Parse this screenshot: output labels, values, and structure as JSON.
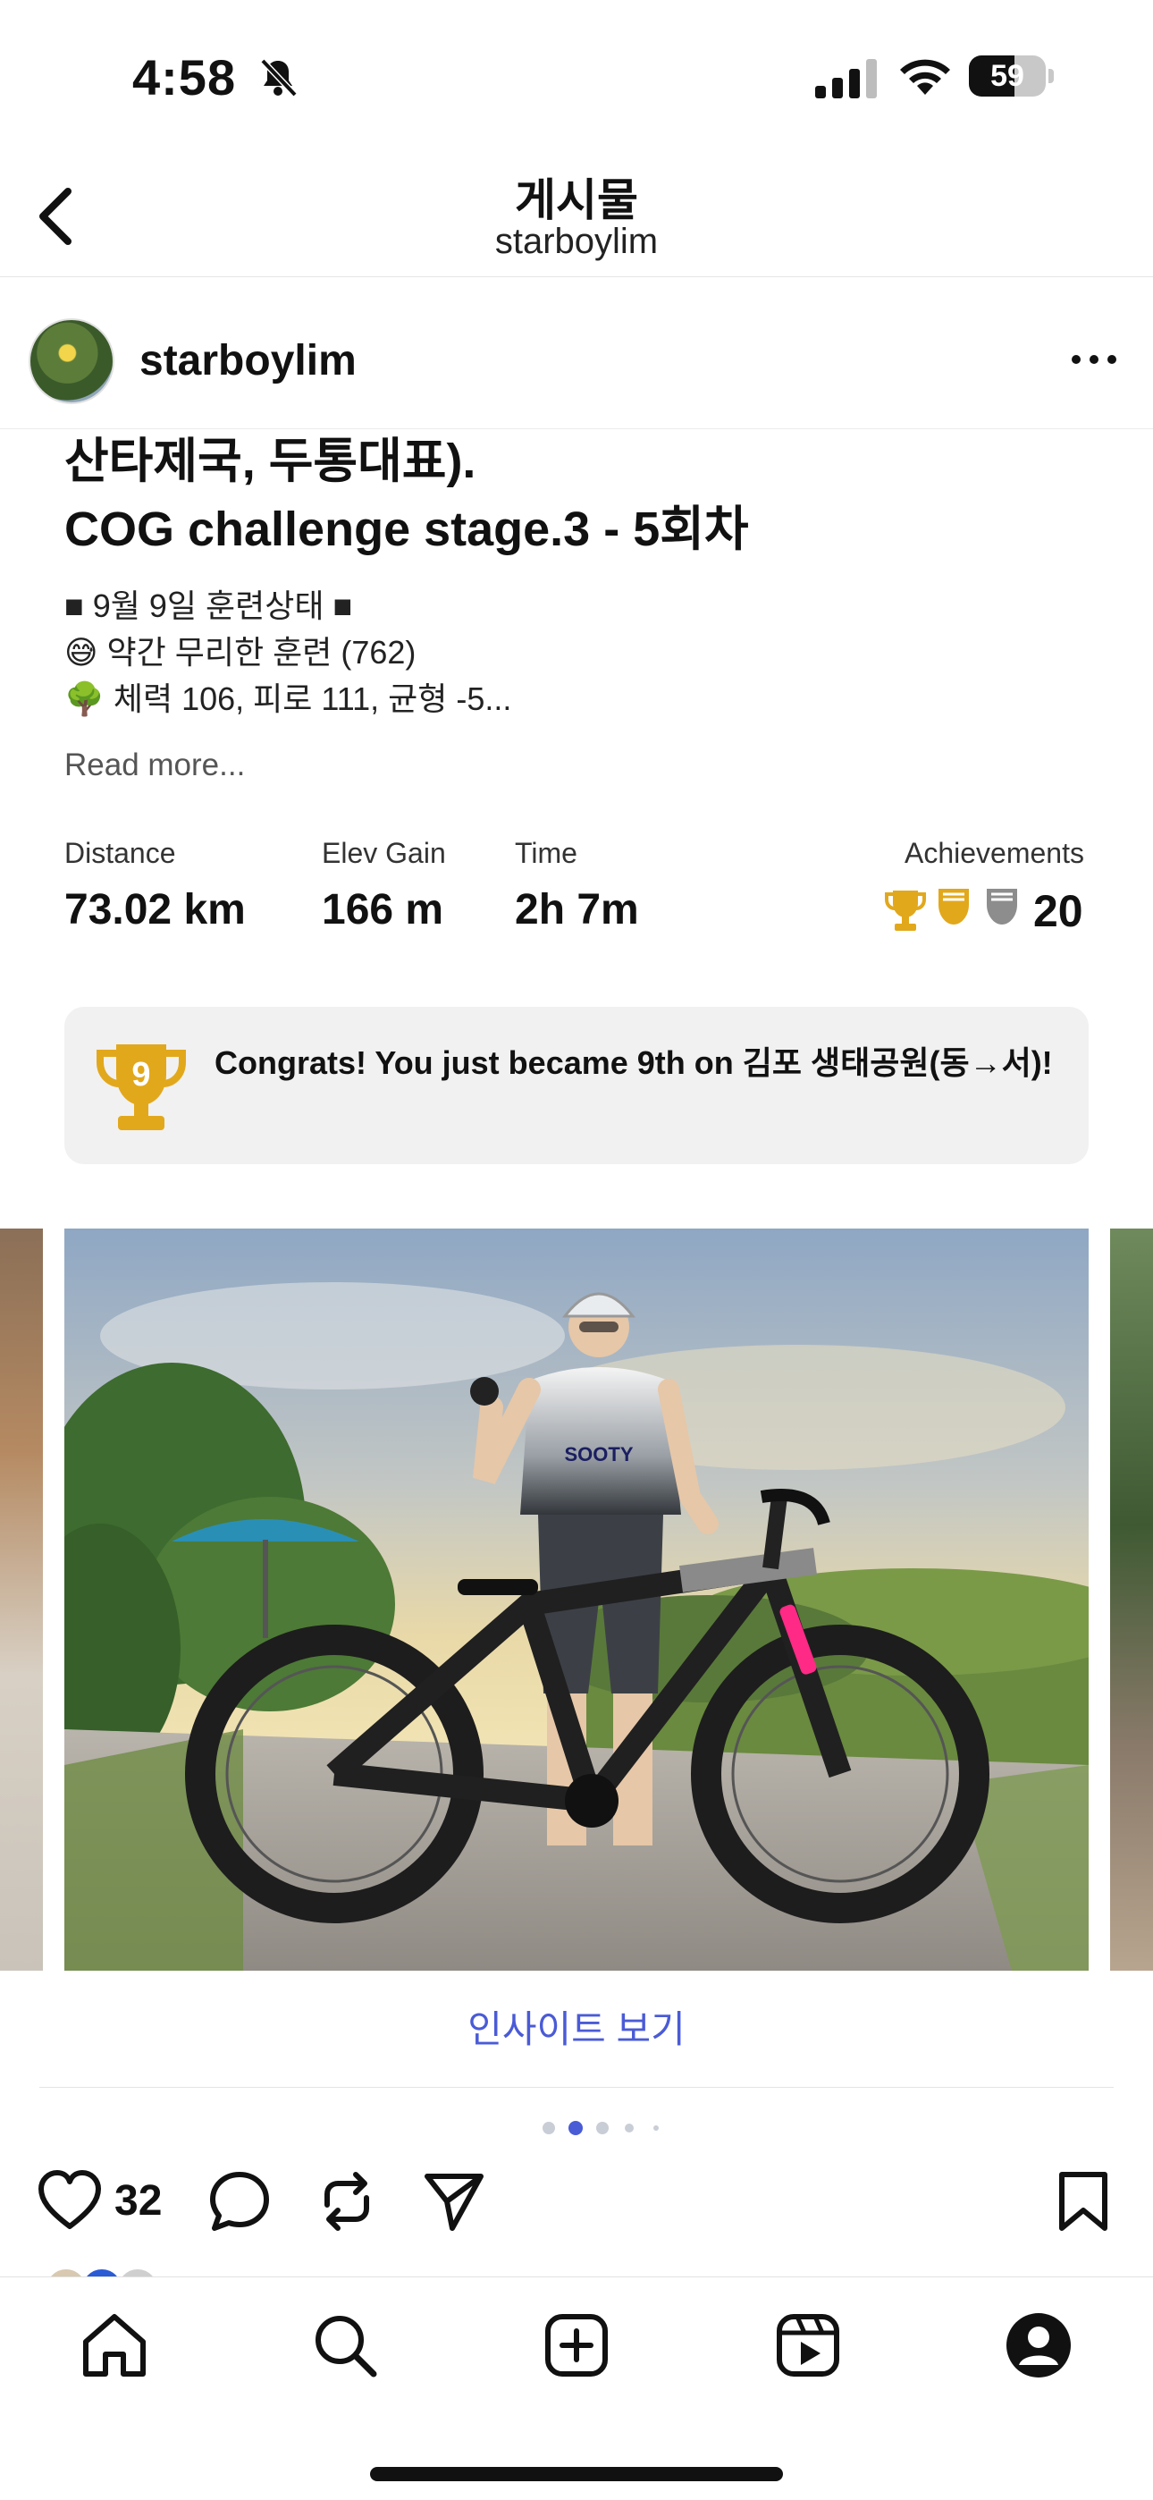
{
  "status_bar": {
    "time": "4:58",
    "battery_level": "59",
    "battery_fraction": 0.59,
    "icons": [
      "bell-slash-icon",
      "cellular-signal-icon",
      "wifi-icon",
      "battery-icon"
    ]
  },
  "header": {
    "title": "게시물",
    "subtitle": "starboylim",
    "back_icon": "chevron-left-icon"
  },
  "post": {
    "username": "starboylim",
    "menu_icon": "more-horizontal-icon",
    "caption_title_line1": "산타제국, 두통대표).",
    "caption_title_line2": "COG challenge stage.3 - 5회차",
    "caption_line1": "■ 9월 9일 훈련상태 ■",
    "caption_line2": "😅 약간 무리한 훈련 (762)",
    "caption_line3": "🌳 체력 106, 피로 111, 균형 -5...",
    "read_more": "Read more...",
    "stats": {
      "distance_label": "Distance",
      "distance_value": "73.02 km",
      "elev_label": "Elev Gain",
      "elev_value": "166 m",
      "time_label": "Time",
      "time_value": "2h 7m",
      "achievements_label": "Achievements",
      "achievements_count": "20"
    },
    "congrats_text": "Congrats! You just became 9th on 김포 생태공원(동→서)!",
    "trophy_rank": "9",
    "insight_link": "인사이트 보기",
    "carousel_pages": 5,
    "carousel_active_index": 1,
    "likes": "32"
  },
  "colors": {
    "link_blue": "#4a5bd6",
    "gold": "#e2a81c",
    "silver": "#8d8d8d",
    "congrats_bg": "#f1f1f1"
  },
  "bottom_nav": [
    "home-icon",
    "search-icon",
    "create-icon",
    "reels-icon",
    "profile-icon"
  ]
}
